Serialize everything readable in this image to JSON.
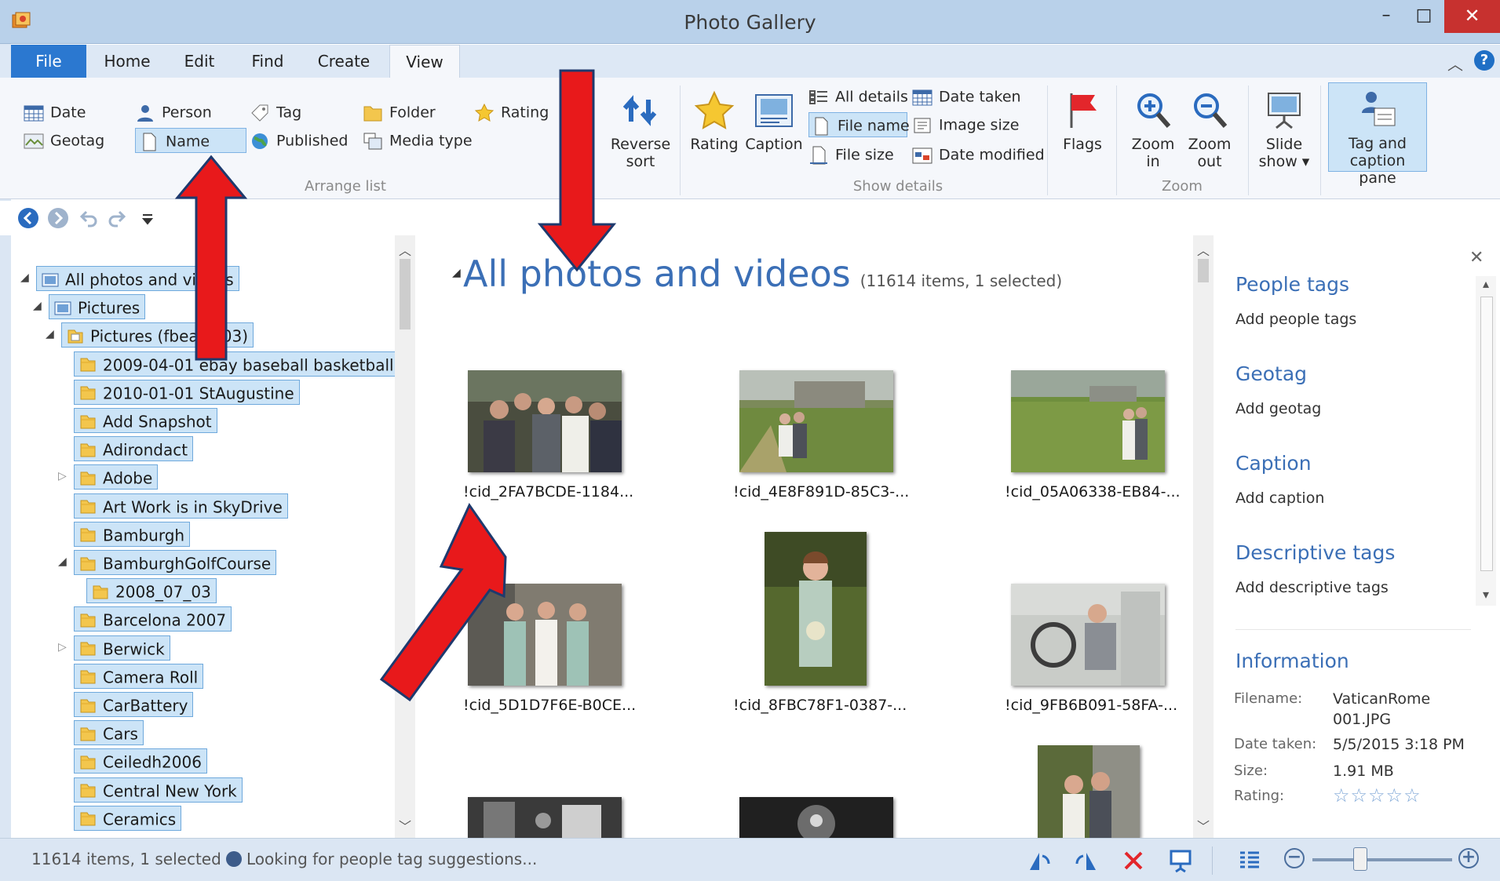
{
  "window": {
    "title": "Photo Gallery",
    "minimize_glyph": "–",
    "maximize_glyph": "□",
    "close_glyph": "✕"
  },
  "tabs": [
    "File",
    "Home",
    "Edit",
    "Find",
    "Create",
    "View"
  ],
  "ribbon": {
    "arrange": {
      "date": "Date",
      "geotag": "Geotag",
      "person": "Person",
      "name": "Name",
      "tag": "Tag",
      "published": "Published",
      "folder": "Folder",
      "media_type": "Media type",
      "rating": "Rating",
      "group_label": "Arrange list"
    },
    "reverse_sort": [
      "Reverse",
      "sort"
    ],
    "show_details": {
      "rating": "Rating",
      "caption": "Caption",
      "all_details": "All details",
      "file_name": "File name",
      "file_size": "File size",
      "date_taken": "Date taken",
      "image_size": "Image size",
      "date_modified": "Date modified",
      "group_label": "Show details"
    },
    "flags": "Flags",
    "zoom": {
      "zoom_in": [
        "Zoom",
        "in"
      ],
      "zoom_out": [
        "Zoom",
        "out"
      ],
      "group_label": "Zoom"
    },
    "slide_show": [
      "Slide",
      "show ▾"
    ],
    "tag_caption_pane": [
      "Tag and",
      "caption pane"
    ]
  },
  "tree": [
    {
      "label": "All photos and videos",
      "level": 0,
      "expanded": true
    },
    {
      "label": "Pictures",
      "level": 1,
      "expanded": true
    },
    {
      "label": "Pictures (fbeavi103)",
      "level": 2,
      "expanded": true
    },
    {
      "label": "2009-04-01 ebay baseball basketball",
      "level": 3
    },
    {
      "label": "2010-01-01 StAugustine",
      "level": 3
    },
    {
      "label": "Add Snapshot",
      "level": 3
    },
    {
      "label": "Adirondact",
      "level": 3
    },
    {
      "label": "Adobe",
      "level": 3,
      "expander": "collapsed"
    },
    {
      "label": "Art Work is in SkyDrive",
      "level": 3
    },
    {
      "label": "Bamburgh",
      "level": 3
    },
    {
      "label": "BamburghGolfCourse",
      "level": 3,
      "expanded": true
    },
    {
      "label": "2008_07_03",
      "level": 4
    },
    {
      "label": "Barcelona 2007",
      "level": 3
    },
    {
      "label": "Berwick",
      "level": 3,
      "expander": "collapsed"
    },
    {
      "label": "Camera Roll",
      "level": 3
    },
    {
      "label": "CarBattery",
      "level": 3
    },
    {
      "label": "Cars",
      "level": 3
    },
    {
      "label": "Ceiledh2006",
      "level": 3
    },
    {
      "label": "Central New York",
      "level": 3
    },
    {
      "label": "Ceramics",
      "level": 3
    }
  ],
  "gallery": {
    "title": "All photos and videos",
    "count": "(11614 items, 1 selected)",
    "items": [
      "!cid_2FA7BCDE-1184...",
      "!cid_4E8F891D-85C3-...",
      "!cid_05A06338-EB84-...",
      "!cid_5D1D7F6E-B0CE...",
      "!cid_8FBC78F1-0387-...",
      "!cid_9FB6B091-58FA-..."
    ]
  },
  "info_pane": {
    "people_tags": "People tags",
    "add_people_tags": "Add people tags",
    "geotag": "Geotag",
    "add_geotag": "Add geotag",
    "caption": "Caption",
    "add_caption": "Add caption",
    "descriptive_tags": "Descriptive tags",
    "add_descriptive_tags": "Add descriptive tags",
    "information": "Information",
    "filename_label": "Filename:",
    "filename_value_1": "VaticanRome",
    "filename_value_2": "001.JPG",
    "date_taken_label": "Date taken:",
    "date_taken_value": "5/5/2015  3:18 PM",
    "size_label": "Size:",
    "size_value": "1.91 MB",
    "rating_label": "Rating:",
    "rating_stars": "☆☆☆☆☆"
  },
  "status": {
    "count": "11614 items, 1 selected",
    "message": "Looking for people tag suggestions..."
  },
  "colors": {
    "accent": "#2b78d0",
    "heading_blue": "#3b6fb6",
    "selection": "#cce4f7",
    "annotation_red": "#e8191b",
    "close_red": "#c7312f"
  }
}
